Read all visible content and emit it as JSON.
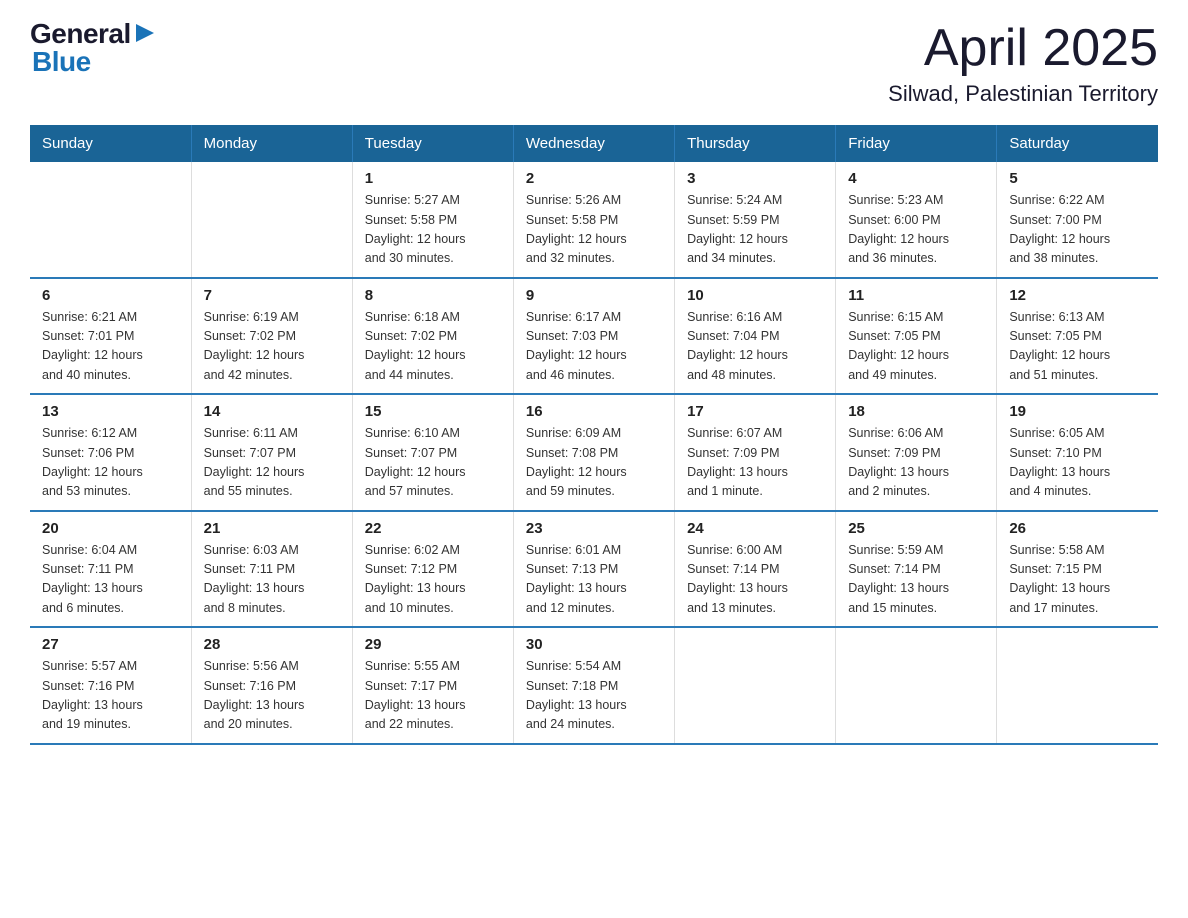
{
  "header": {
    "logo_general": "General",
    "logo_blue": "Blue",
    "title": "April 2025",
    "subtitle": "Silwad, Palestinian Territory"
  },
  "days_of_week": [
    "Sunday",
    "Monday",
    "Tuesday",
    "Wednesday",
    "Thursday",
    "Friday",
    "Saturday"
  ],
  "weeks": [
    [
      {
        "day": "",
        "info": ""
      },
      {
        "day": "",
        "info": ""
      },
      {
        "day": "1",
        "info": "Sunrise: 5:27 AM\nSunset: 5:58 PM\nDaylight: 12 hours\nand 30 minutes."
      },
      {
        "day": "2",
        "info": "Sunrise: 5:26 AM\nSunset: 5:58 PM\nDaylight: 12 hours\nand 32 minutes."
      },
      {
        "day": "3",
        "info": "Sunrise: 5:24 AM\nSunset: 5:59 PM\nDaylight: 12 hours\nand 34 minutes."
      },
      {
        "day": "4",
        "info": "Sunrise: 5:23 AM\nSunset: 6:00 PM\nDaylight: 12 hours\nand 36 minutes."
      },
      {
        "day": "5",
        "info": "Sunrise: 6:22 AM\nSunset: 7:00 PM\nDaylight: 12 hours\nand 38 minutes."
      }
    ],
    [
      {
        "day": "6",
        "info": "Sunrise: 6:21 AM\nSunset: 7:01 PM\nDaylight: 12 hours\nand 40 minutes."
      },
      {
        "day": "7",
        "info": "Sunrise: 6:19 AM\nSunset: 7:02 PM\nDaylight: 12 hours\nand 42 minutes."
      },
      {
        "day": "8",
        "info": "Sunrise: 6:18 AM\nSunset: 7:02 PM\nDaylight: 12 hours\nand 44 minutes."
      },
      {
        "day": "9",
        "info": "Sunrise: 6:17 AM\nSunset: 7:03 PM\nDaylight: 12 hours\nand 46 minutes."
      },
      {
        "day": "10",
        "info": "Sunrise: 6:16 AM\nSunset: 7:04 PM\nDaylight: 12 hours\nand 48 minutes."
      },
      {
        "day": "11",
        "info": "Sunrise: 6:15 AM\nSunset: 7:05 PM\nDaylight: 12 hours\nand 49 minutes."
      },
      {
        "day": "12",
        "info": "Sunrise: 6:13 AM\nSunset: 7:05 PM\nDaylight: 12 hours\nand 51 minutes."
      }
    ],
    [
      {
        "day": "13",
        "info": "Sunrise: 6:12 AM\nSunset: 7:06 PM\nDaylight: 12 hours\nand 53 minutes."
      },
      {
        "day": "14",
        "info": "Sunrise: 6:11 AM\nSunset: 7:07 PM\nDaylight: 12 hours\nand 55 minutes."
      },
      {
        "day": "15",
        "info": "Sunrise: 6:10 AM\nSunset: 7:07 PM\nDaylight: 12 hours\nand 57 minutes."
      },
      {
        "day": "16",
        "info": "Sunrise: 6:09 AM\nSunset: 7:08 PM\nDaylight: 12 hours\nand 59 minutes."
      },
      {
        "day": "17",
        "info": "Sunrise: 6:07 AM\nSunset: 7:09 PM\nDaylight: 13 hours\nand 1 minute."
      },
      {
        "day": "18",
        "info": "Sunrise: 6:06 AM\nSunset: 7:09 PM\nDaylight: 13 hours\nand 2 minutes."
      },
      {
        "day": "19",
        "info": "Sunrise: 6:05 AM\nSunset: 7:10 PM\nDaylight: 13 hours\nand 4 minutes."
      }
    ],
    [
      {
        "day": "20",
        "info": "Sunrise: 6:04 AM\nSunset: 7:11 PM\nDaylight: 13 hours\nand 6 minutes."
      },
      {
        "day": "21",
        "info": "Sunrise: 6:03 AM\nSunset: 7:11 PM\nDaylight: 13 hours\nand 8 minutes."
      },
      {
        "day": "22",
        "info": "Sunrise: 6:02 AM\nSunset: 7:12 PM\nDaylight: 13 hours\nand 10 minutes."
      },
      {
        "day": "23",
        "info": "Sunrise: 6:01 AM\nSunset: 7:13 PM\nDaylight: 13 hours\nand 12 minutes."
      },
      {
        "day": "24",
        "info": "Sunrise: 6:00 AM\nSunset: 7:14 PM\nDaylight: 13 hours\nand 13 minutes."
      },
      {
        "day": "25",
        "info": "Sunrise: 5:59 AM\nSunset: 7:14 PM\nDaylight: 13 hours\nand 15 minutes."
      },
      {
        "day": "26",
        "info": "Sunrise: 5:58 AM\nSunset: 7:15 PM\nDaylight: 13 hours\nand 17 minutes."
      }
    ],
    [
      {
        "day": "27",
        "info": "Sunrise: 5:57 AM\nSunset: 7:16 PM\nDaylight: 13 hours\nand 19 minutes."
      },
      {
        "day": "28",
        "info": "Sunrise: 5:56 AM\nSunset: 7:16 PM\nDaylight: 13 hours\nand 20 minutes."
      },
      {
        "day": "29",
        "info": "Sunrise: 5:55 AM\nSunset: 7:17 PM\nDaylight: 13 hours\nand 22 minutes."
      },
      {
        "day": "30",
        "info": "Sunrise: 5:54 AM\nSunset: 7:18 PM\nDaylight: 13 hours\nand 24 minutes."
      },
      {
        "day": "",
        "info": ""
      },
      {
        "day": "",
        "info": ""
      },
      {
        "day": "",
        "info": ""
      }
    ]
  ]
}
